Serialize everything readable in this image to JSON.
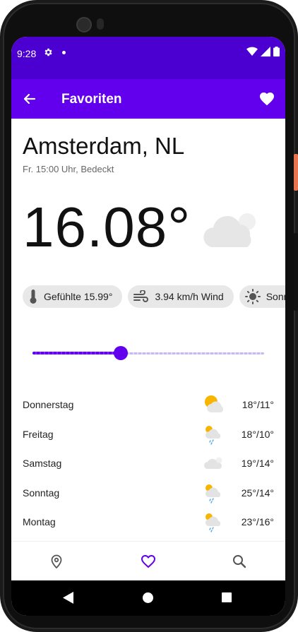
{
  "status": {
    "time": "9:28",
    "icons": [
      "gear-icon",
      "dot-icon",
      "wifi-icon",
      "signal-icon",
      "battery-icon"
    ]
  },
  "appbar": {
    "title": "Favoriten",
    "color": "#6200ee",
    "status_color": "#4b00d1"
  },
  "weather": {
    "city": "Amsterdam, NL",
    "subtitle": "Fr. 15:00 Uhr, Bedeckt",
    "temperature": "16.08°",
    "condition_icon": "cloud-icon"
  },
  "chips": [
    {
      "icon": "thermometer-icon",
      "label": "Gefühlte 15.99°"
    },
    {
      "icon": "wind-icon",
      "label": "3.94 km/h Wind"
    },
    {
      "icon": "sun-icon",
      "label": "Sonn"
    }
  ],
  "slider": {
    "value_fraction": 0.38
  },
  "forecast": [
    {
      "day": "Donnerstag",
      "icon": "partly-sunny-icon",
      "temp": "18°/11°"
    },
    {
      "day": "Freitag",
      "icon": "sun-rain-cloud-icon",
      "temp": "18°/10°"
    },
    {
      "day": "Samstag",
      "icon": "cloud-icon",
      "temp": "19°/14°"
    },
    {
      "day": "Sonntag",
      "icon": "sun-rain-cloud-icon",
      "temp": "25°/14°"
    },
    {
      "day": "Montag",
      "icon": "sun-rain-cloud-icon",
      "temp": "23°/16°"
    }
  ],
  "bottom_nav": {
    "items": [
      {
        "icon": "location-pin-icon",
        "active": false
      },
      {
        "icon": "heart-outline-icon",
        "active": true
      },
      {
        "icon": "search-icon",
        "active": false
      }
    ],
    "active_color": "#6200ee",
    "inactive_color": "#555555"
  }
}
